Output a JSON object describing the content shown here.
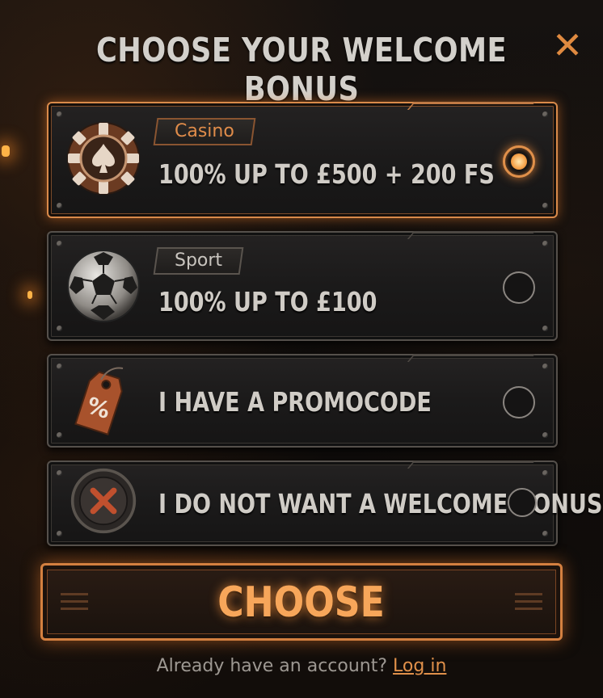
{
  "modal": {
    "title": "CHOOSE YOUR WELCOME BONUS",
    "close_symbol": "✕"
  },
  "options": [
    {
      "tag": "Casino",
      "text": "100% UP TO £500 + 200 FS",
      "icon": "poker-chip-icon",
      "selected": true
    },
    {
      "tag": "Sport",
      "text": "100% UP TO £100",
      "icon": "soccer-ball-icon",
      "selected": false
    },
    {
      "tag": "",
      "text": "I HAVE A PROMOCODE",
      "icon": "percent-tag-icon",
      "selected": false
    },
    {
      "tag": "",
      "text": "I DO NOT WANT A WELCOME BONUS",
      "icon": "cross-coin-icon",
      "selected": false
    }
  ],
  "choose_button": {
    "label": "CHOOSE"
  },
  "footer": {
    "question": "Already have an account?",
    "login_link": "Log in"
  },
  "colors": {
    "accent": "#e0904a",
    "text": "#d0ccc6",
    "background": "#120e0c"
  }
}
